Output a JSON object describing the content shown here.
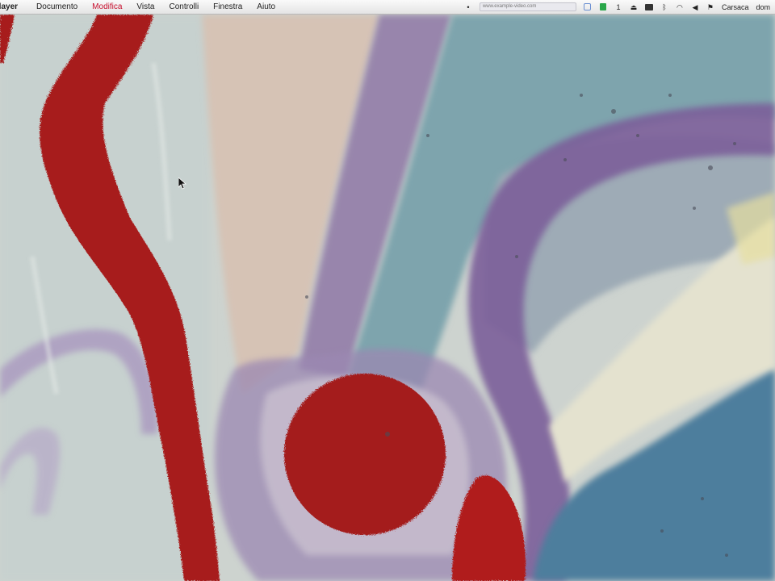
{
  "menubar": {
    "app_name": "Player",
    "items": [
      {
        "label": "Documento"
      },
      {
        "label": "Modifica"
      },
      {
        "label": "Vista"
      },
      {
        "label": "Controlli"
      },
      {
        "label": "Finestra"
      },
      {
        "label": "Aiuto"
      }
    ],
    "active_item": "Modifica",
    "status_field_text": "www.example-video.com",
    "user_name": "Carsaca",
    "clock": "dom"
  },
  "colors": {
    "menu_active": "#c8102e",
    "wall_red": "#a71d1c",
    "wall_purple": "#7b5e9a",
    "wall_blue": "#4e7e9d"
  },
  "icons": [
    "apple-icon",
    "status-field",
    "green-square-icon",
    "blue-square-icon",
    "number-icon",
    "eject-icon",
    "dark-square-icon",
    "bluetooth-icon",
    "wifi-icon",
    "volume-icon",
    "flag-icon",
    "search-icon"
  ],
  "video": {
    "subject": "painted wall",
    "cursor": "arrow-cursor"
  }
}
